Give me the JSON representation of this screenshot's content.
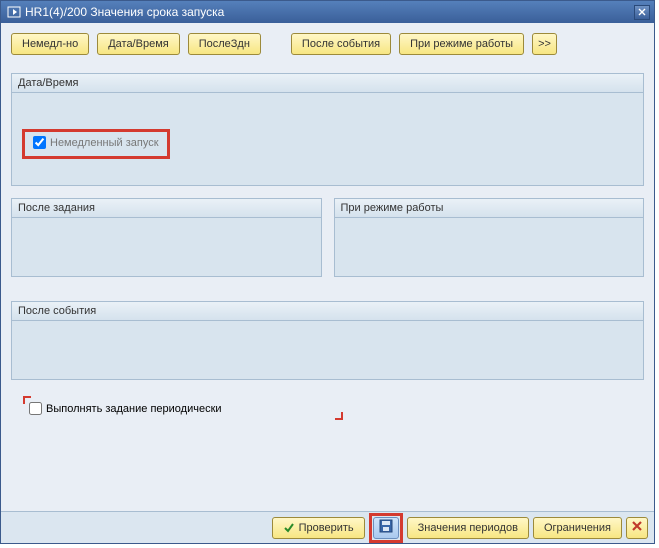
{
  "window": {
    "title": "HR1(4)/200 Значения срока запуска"
  },
  "topButtons": {
    "immediate": "Немедл-но",
    "dateTime": "Дата/Время",
    "afterJobShort": "ПослеЗдн",
    "afterEvent": "После события",
    "workMode": "При режиме работы",
    "more": ">>"
  },
  "groups": {
    "dateTime": {
      "title": "Дата/Время",
      "immediateStart": "Немедленный запуск",
      "immediateChecked": true
    },
    "afterJob": {
      "title": "После задания"
    },
    "workMode": {
      "title": "При режиме работы"
    },
    "afterEvent": {
      "title": "После события"
    }
  },
  "periodic": {
    "label": "Выполнять задание периодически",
    "checked": false
  },
  "footer": {
    "check": "Проверить",
    "periodValues": "Значения периодов",
    "restrictions": "Ограничения"
  }
}
